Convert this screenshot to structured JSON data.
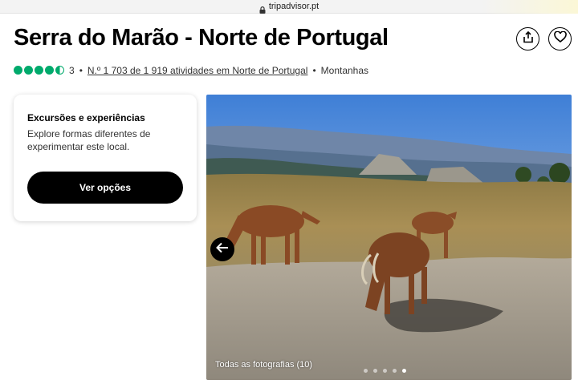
{
  "browser": {
    "domain": "tripadvisor.pt"
  },
  "header": {
    "title": "Serra do Marão - Norte de Portugal",
    "share_icon": "share-icon",
    "heart_icon": "heart-icon"
  },
  "rating": {
    "score": 4.5,
    "max": 5,
    "review_count": "3",
    "separator": "•",
    "rank_text": "N.º 1 703 de 1 919 atividades em Norte de Portugal",
    "category": "Montanhas",
    "bubble_color": "#00aa6c"
  },
  "card": {
    "title": "Excursões e experiências",
    "description": "Explore formas diferentes de experimentar este local.",
    "button_label": "Ver opções"
  },
  "gallery": {
    "all_photos_label": "Todas as fotografias (10)",
    "dot_count": 5,
    "active_dot": 4,
    "prev_icon": "arrow-left-icon"
  }
}
